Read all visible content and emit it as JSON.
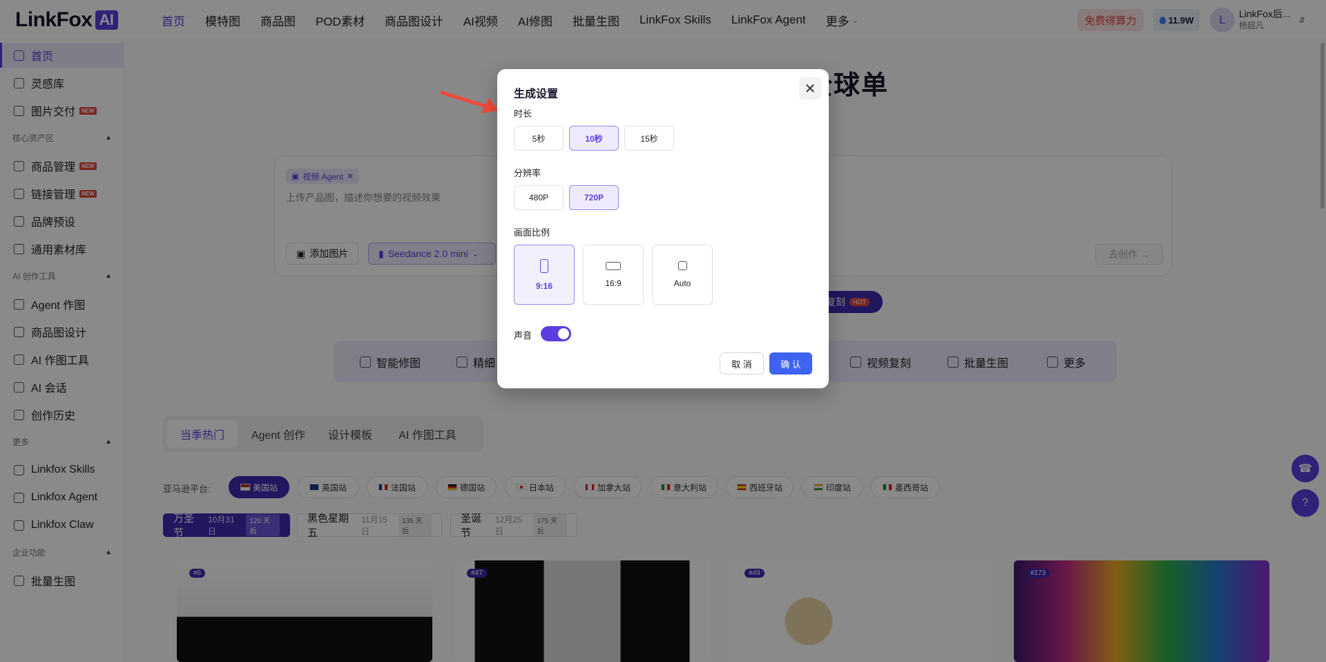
{
  "logo": {
    "text": "LinkFox",
    "badge": "AI"
  },
  "nav": [
    "首页",
    "模特图",
    "商品图",
    "POD素材",
    "商品图设计",
    "AI视频",
    "AI修图",
    "批量生图",
    "LinkFox Skills",
    "LinkFox Agent",
    "更多"
  ],
  "header": {
    "free_label": "免费得算力",
    "credits": "11.9W",
    "avatar_letter": "L",
    "user_name": "LinkFox后...",
    "user_sub": "杨超凡"
  },
  "sidebar": {
    "items_top": [
      {
        "label": "首页"
      },
      {
        "label": "灵感库"
      },
      {
        "label": "图片交付",
        "badge": "NEW"
      }
    ],
    "group_core": "核心资产区",
    "items_core": [
      {
        "label": "商品管理",
        "badge": "NEW"
      },
      {
        "label": "链接管理",
        "badge": "NEW"
      },
      {
        "label": "品牌预设"
      },
      {
        "label": "通用素材库"
      }
    ],
    "group_ai": "AI 创作工具",
    "items_ai": [
      {
        "label": "Agent 作图"
      },
      {
        "label": "商品图设计"
      },
      {
        "label": "AI 作图工具"
      },
      {
        "label": "AI 会话"
      },
      {
        "label": "创作历史"
      }
    ],
    "group_more": "更多",
    "items_more": [
      {
        "label": "Linkfox Skills"
      },
      {
        "label": "Linkfox Agent"
      },
      {
        "label": "Linkfox Claw"
      }
    ],
    "group_ent": "企业功能",
    "items_ent": [
      {
        "label": "批量生图"
      }
    ]
  },
  "hero": {
    "title": "Al一个想法，引爆全球单"
  },
  "chat": {
    "agent_tag": "视频 Agent",
    "placeholder": "上传产品图，描述你想要的视频效果",
    "add_image": "添加图片",
    "model": "Seedance 2.0 mini",
    "go": "去创作"
  },
  "pill": {
    "label": "复刻",
    "hot": "HOT"
  },
  "tools": [
    "智能修图",
    "精细",
    "视频复刻",
    "批量生图",
    "更多"
  ],
  "tabs": [
    "当季热门",
    "Agent 创作",
    "设计模板",
    "AI 作图工具"
  ],
  "platform": {
    "label": "亚马逊平台:",
    "sites": [
      "美国站",
      "英国站",
      "法国站",
      "德国站",
      "日本站",
      "加拿大站",
      "意大利站",
      "西班牙站",
      "印度站",
      "墨西哥站"
    ]
  },
  "holidays": [
    {
      "name": "万圣节",
      "date": "10月31日",
      "days": "120 天后"
    },
    {
      "name": "黑色星期五",
      "date": "11月15日",
      "days": "135 天后"
    },
    {
      "name": "圣诞节",
      "date": "12月25日",
      "days": "175 天后"
    }
  ],
  "cards": [
    "#6",
    "#47",
    "#49",
    "#173"
  ],
  "modal": {
    "title": "生成设置",
    "duration_label": "时长",
    "durations": [
      "5秒",
      "10秒",
      "15秒"
    ],
    "duration_selected": "10秒",
    "resolution_label": "分辨率",
    "resolutions": [
      "480P",
      "720P"
    ],
    "resolution_selected": "720P",
    "ratio_label": "画面比例",
    "ratios": [
      "9:16",
      "16:9",
      "Auto"
    ],
    "ratio_selected": "9:16",
    "sound_label": "声音",
    "sound_on": true,
    "cancel": "取 消",
    "confirm": "确 认"
  },
  "colors": {
    "accent": "#5b3de0",
    "confirm": "#3e63f0",
    "hot": "#e0473d"
  }
}
